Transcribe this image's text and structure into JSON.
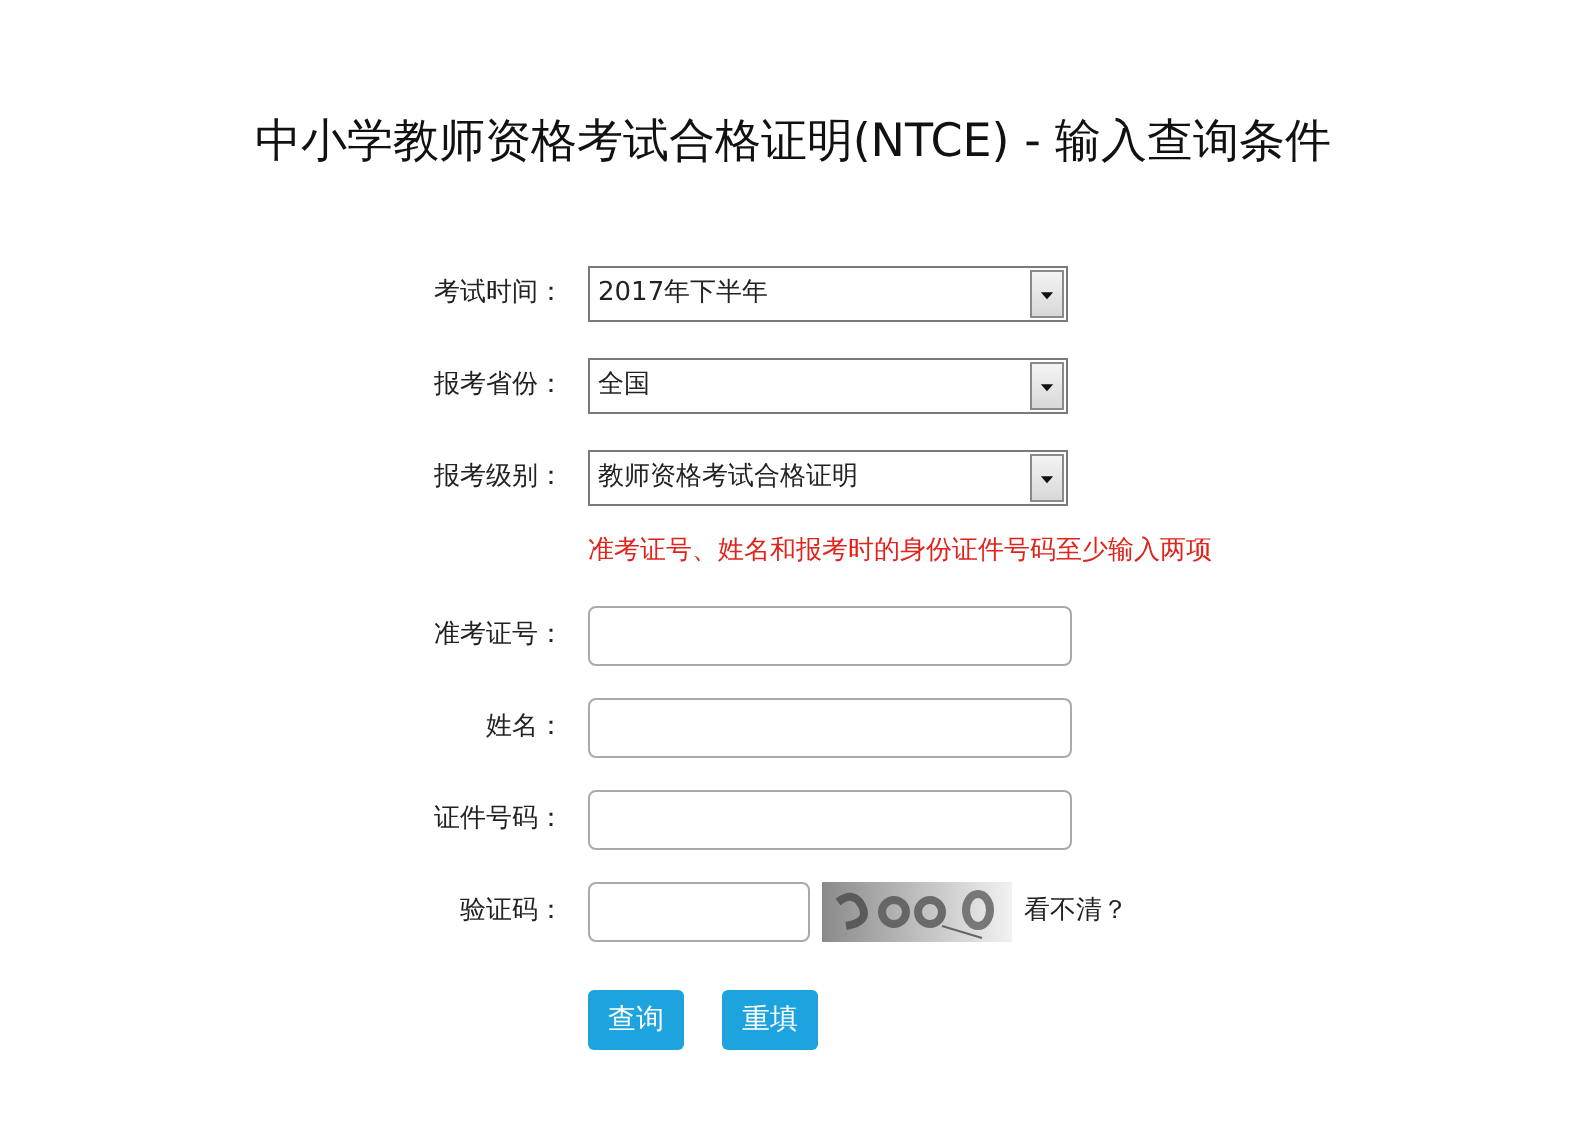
{
  "title": "中小学教师资格考试合格证明(NTCE) - 输入查询条件",
  "dropdowns": [
    {
      "label": "考试时间：",
      "value": "2017年下半年"
    },
    {
      "label": "报考省份：",
      "value": "全国"
    },
    {
      "label": "报考级别：",
      "value": "教师资格考试合格证明"
    }
  ],
  "hint": "准考证号、姓名和报考时的身份证件号码至少输入两项",
  "fields": [
    {
      "label": "准考证号："
    },
    {
      "label": "姓名："
    },
    {
      "label": "证件号码："
    }
  ],
  "captcha": {
    "label": "验证码：",
    "refresh_link": "看不清？"
  },
  "buttons": [
    "查询",
    "重填"
  ]
}
